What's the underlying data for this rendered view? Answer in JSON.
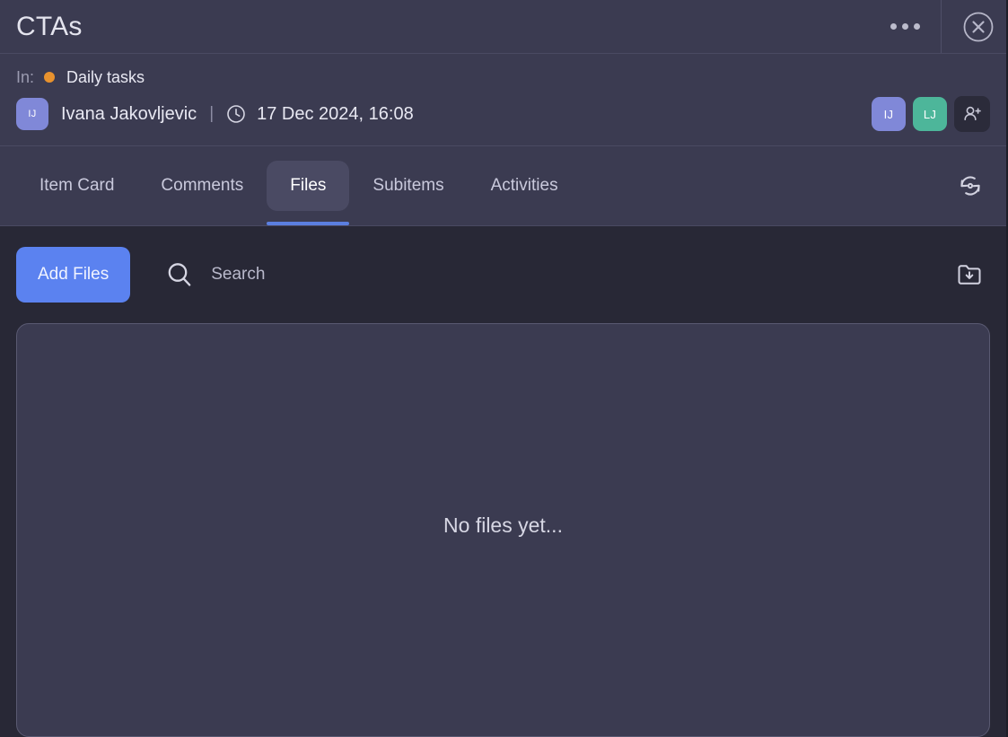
{
  "window": {
    "title": "CTAs",
    "more_icon": "ellipsis-icon",
    "close_icon": "close-circle-icon"
  },
  "meta": {
    "in_label": "In:",
    "board_name": "Daily tasks",
    "board_dot_color": "#e8922e",
    "owner_initials": "IJ",
    "owner_name": "Ivana Jakovljevic",
    "separator": "|",
    "clock_icon": "clock-icon",
    "timestamp": "17 Dec 2024, 16:08",
    "members": [
      {
        "initials": "IJ",
        "color": "#8088d8"
      },
      {
        "initials": "LJ",
        "color": "#4db69a"
      }
    ],
    "add_person_icon": "person-add-icon"
  },
  "tabs": {
    "items": [
      {
        "label": "Item  Card",
        "name": "item-card",
        "active": false
      },
      {
        "label": "Comments",
        "name": "comments",
        "active": false
      },
      {
        "label": "Files",
        "name": "files",
        "active": true
      },
      {
        "label": "Subitems",
        "name": "subitems",
        "active": false
      },
      {
        "label": "Activities",
        "name": "activities",
        "active": false
      }
    ],
    "refresh_icon": "refresh-icon",
    "active_underline_color": "#5b7fe0"
  },
  "toolbar": {
    "add_files_label": "Add Files",
    "add_files_color": "#5b82f0",
    "search_icon": "search-icon",
    "search_value": "",
    "search_placeholder": "Search",
    "download_icon": "folder-download-icon"
  },
  "files_panel": {
    "empty_message": "No files yet..."
  }
}
